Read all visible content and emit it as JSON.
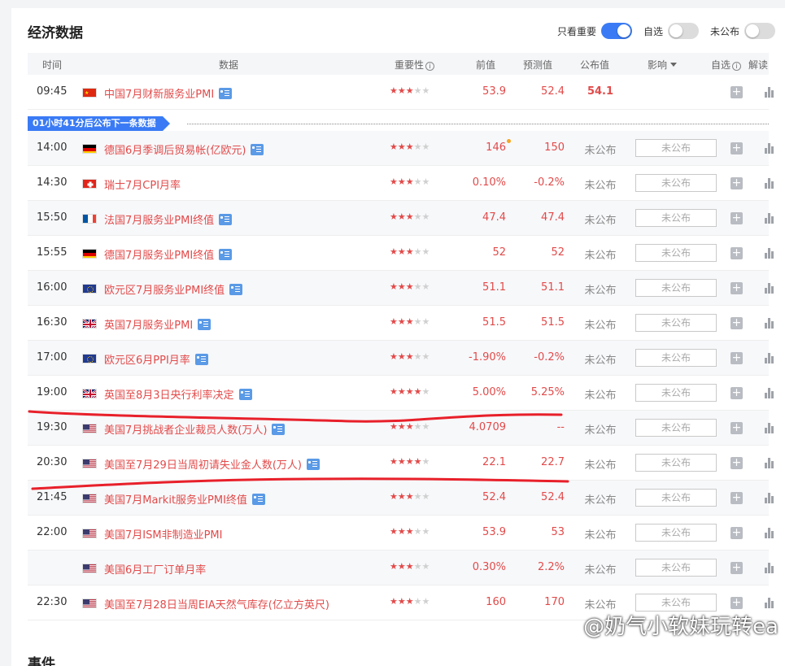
{
  "title": "经济数据",
  "toggles": [
    {
      "label": "只看重要",
      "on": true
    },
    {
      "label": "自选",
      "on": false
    },
    {
      "label": "未公布",
      "on": false
    }
  ],
  "headers": {
    "time": "时间",
    "data": "数据",
    "importance": "重要性",
    "prev": "前值",
    "forecast": "预测值",
    "published": "公布值",
    "impact": "影响",
    "watchlist": "自选",
    "analysis": "解读"
  },
  "countdown": "01小时41分后公布下一条数据",
  "first_row": {
    "time": "09:45",
    "flag": "CN",
    "name": "中国7月财新服务业PMI",
    "stars": 3,
    "prev": "53.9",
    "forecast": "52.4",
    "published": "54.1"
  },
  "rows": [
    {
      "time": "14:00",
      "flag": "DE",
      "name": "德国6月季调后贸易帐(亿欧元)",
      "doc": true,
      "stars": 3,
      "prev": "146",
      "revised": true,
      "forecast": "150",
      "published": "未公布",
      "impact": "未公布"
    },
    {
      "time": "14:30",
      "flag": "CH",
      "name": "瑞士7月CPI月率",
      "doc": false,
      "stars": 3,
      "prev": "0.10%",
      "forecast": "-0.2%",
      "published": "未公布",
      "impact": "未公布"
    },
    {
      "time": "15:50",
      "flag": "FR",
      "name": "法国7月服务业PMI终值",
      "doc": true,
      "stars": 3,
      "prev": "47.4",
      "forecast": "47.4",
      "published": "未公布",
      "impact": "未公布"
    },
    {
      "time": "15:55",
      "flag": "DE",
      "name": "德国7月服务业PMI终值",
      "doc": true,
      "stars": 3,
      "prev": "52",
      "forecast": "52",
      "published": "未公布",
      "impact": "未公布"
    },
    {
      "time": "16:00",
      "flag": "EU",
      "name": "欧元区7月服务业PMI终值",
      "doc": true,
      "stars": 3,
      "prev": "51.1",
      "forecast": "51.1",
      "published": "未公布",
      "impact": "未公布"
    },
    {
      "time": "16:30",
      "flag": "GB",
      "name": "英国7月服务业PMI",
      "doc": true,
      "stars": 3,
      "prev": "51.5",
      "forecast": "51.5",
      "published": "未公布",
      "impact": "未公布"
    },
    {
      "time": "17:00",
      "flag": "EU",
      "name": "欧元区6月PPI月率",
      "doc": true,
      "stars": 3,
      "prev": "-1.90%",
      "forecast": "-0.2%",
      "published": "未公布",
      "impact": "未公布"
    },
    {
      "time": "19:00",
      "flag": "GB",
      "name": "英国至8月3日央行利率决定",
      "doc": true,
      "stars": 4,
      "prev": "5.00%",
      "forecast": "5.25%",
      "published": "未公布",
      "impact": "未公布"
    },
    {
      "time": "19:30",
      "flag": "US",
      "name": "美国7月挑战者企业裁员人数(万人)",
      "doc": true,
      "stars": 3,
      "prev": "4.0709",
      "forecast": "--",
      "published": "未公布",
      "impact": "未公布"
    },
    {
      "time": "20:30",
      "flag": "US",
      "name": "美国至7月29日当周初请失业金人数(万人)",
      "doc": true,
      "stars": 4,
      "prev": "22.1",
      "forecast": "22.7",
      "published": "未公布",
      "impact": "未公布"
    },
    {
      "time": "21:45",
      "flag": "US",
      "name": "美国7月Markit服务业PMI终值",
      "doc": true,
      "stars": 3,
      "prev": "52.4",
      "forecast": "52.4",
      "published": "未公布",
      "impact": "未公布"
    },
    {
      "time": "22:00",
      "flag": "US",
      "name": "美国7月ISM非制造业PMI",
      "doc": false,
      "stars": 3,
      "prev": "53.9",
      "forecast": "53",
      "published": "未公布",
      "impact": "未公布"
    },
    {
      "time": "",
      "flag": "US",
      "name": "美国6月工厂订单月率",
      "doc": false,
      "stars": 3,
      "prev": "0.30%",
      "forecast": "2.2%",
      "published": "未公布",
      "impact": "未公布"
    },
    {
      "time": "22:30",
      "flag": "US",
      "name": "美国至7月28日当周EIA天然气库存(亿立方英尺)",
      "doc": false,
      "stars": 3,
      "prev": "160",
      "forecast": "170",
      "published": "未公布",
      "impact": "未公布"
    }
  ],
  "events_title": "事件",
  "watermark": "@奶气小软妹玩转ea",
  "colors": {
    "accent": "#3a7bf5",
    "red": "#e24a4a",
    "annotation": "#e8202a"
  }
}
